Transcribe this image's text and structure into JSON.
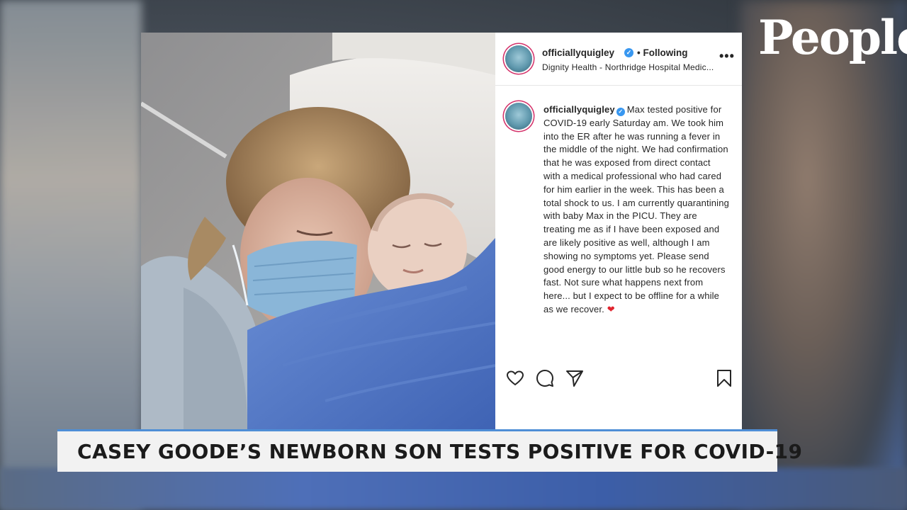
{
  "brand": {
    "logo_text": "People"
  },
  "post": {
    "header": {
      "username": "officiallyquigley",
      "verified_mark": "✓",
      "follow_status": "• Following",
      "location": "Dignity Health - Northridge Hospital Medic...",
      "more_glyph": "•••"
    },
    "caption": {
      "username": "officiallyquigley",
      "verified_mark": "✓",
      "text": "Max tested positive for COVID-19 early Saturday am. We took him into the ER after he was running a fever in the middle of the night. We had confirmation that he was exposed from direct contact with a medical professional who had cared for him earlier in the week. This has been a total shock to us. I am currently quarantining with baby Max in the PICU. They are treating me as if I have been exposed and are likely positive as well, although I am showing no symptoms yet. Please send good energy to our little bub so he recovers fast. Not sure what happens next from here... but I expect to be offline for a while as we recover. ",
      "emoji": "❤"
    },
    "actions": {
      "like_icon": "heart-outline-icon",
      "comment_icon": "comment-bubble-icon",
      "share_icon": "paper-plane-icon",
      "save_icon": "bookmark-icon"
    }
  },
  "lower_third": {
    "headline": "CASEY GOODE’S NEWBORN SON TESTS POSITIVE FOR COVID-19"
  },
  "colors": {
    "accent_bar": "#4e8ed6",
    "verified_blue": "#3897f0",
    "heart_red": "#e0242e"
  }
}
